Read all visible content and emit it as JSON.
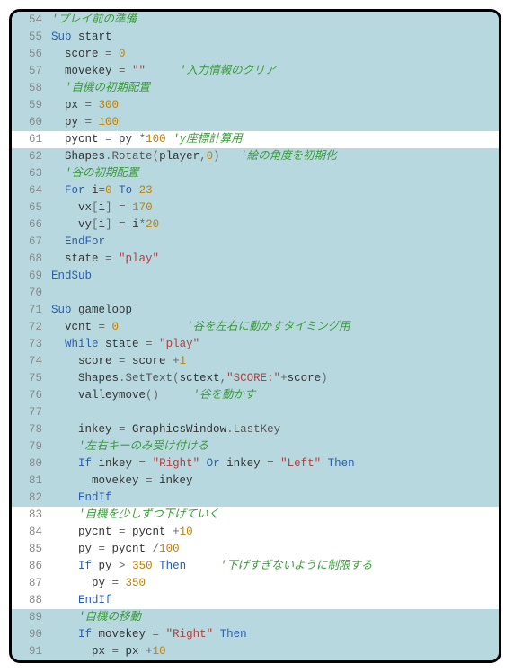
{
  "line_start": 54,
  "current_line": 61,
  "lines": [
    {
      "n": 54,
      "sel": true,
      "tokens": [
        {
          "c": "com",
          "t": "'プレイ前の準備"
        }
      ]
    },
    {
      "n": 55,
      "sel": true,
      "tokens": [
        {
          "c": "kw",
          "t": "Sub "
        },
        {
          "c": "ident",
          "t": "start"
        }
      ]
    },
    {
      "n": 56,
      "sel": true,
      "tokens": [
        {
          "c": "",
          "t": "  "
        },
        {
          "c": "ident",
          "t": "score "
        },
        {
          "c": "op",
          "t": "= "
        },
        {
          "c": "num",
          "t": "0"
        }
      ]
    },
    {
      "n": 57,
      "sel": true,
      "tokens": [
        {
          "c": "",
          "t": "  "
        },
        {
          "c": "ident",
          "t": "movekey "
        },
        {
          "c": "op",
          "t": "= "
        },
        {
          "c": "str",
          "t": "\"\""
        },
        {
          "c": "",
          "t": "     "
        },
        {
          "c": "com",
          "t": "'入力情報のクリア"
        }
      ]
    },
    {
      "n": 58,
      "sel": true,
      "tokens": [
        {
          "c": "",
          "t": "  "
        },
        {
          "c": "com",
          "t": "'自機の初期配置"
        }
      ]
    },
    {
      "n": 59,
      "sel": true,
      "tokens": [
        {
          "c": "",
          "t": "  "
        },
        {
          "c": "ident",
          "t": "px "
        },
        {
          "c": "op",
          "t": "= "
        },
        {
          "c": "num",
          "t": "300"
        }
      ]
    },
    {
      "n": 60,
      "sel": true,
      "tokens": [
        {
          "c": "",
          "t": "  "
        },
        {
          "c": "ident",
          "t": "py "
        },
        {
          "c": "op",
          "t": "= "
        },
        {
          "c": "num",
          "t": "100"
        }
      ]
    },
    {
      "n": 61,
      "sel": false,
      "tokens": [
        {
          "c": "",
          "t": "  "
        },
        {
          "c": "ident",
          "t": "pycnt "
        },
        {
          "c": "op",
          "t": "= "
        },
        {
          "c": "ident",
          "t": "py "
        },
        {
          "c": "op",
          "t": "*"
        },
        {
          "c": "num",
          "t": "100 "
        },
        {
          "c": "com",
          "t": "'y座標計算用"
        }
      ]
    },
    {
      "n": 62,
      "sel": true,
      "tokens": [
        {
          "c": "",
          "t": "  "
        },
        {
          "c": "ident",
          "t": "Shapes"
        },
        {
          "c": "op",
          "t": "."
        },
        {
          "c": "member",
          "t": "Rotate"
        },
        {
          "c": "op",
          "t": "("
        },
        {
          "c": "ident",
          "t": "player"
        },
        {
          "c": "op",
          "t": ","
        },
        {
          "c": "num",
          "t": "0"
        },
        {
          "c": "op",
          "t": ")   "
        },
        {
          "c": "com",
          "t": "'絵の角度を初期化"
        }
      ]
    },
    {
      "n": 63,
      "sel": true,
      "tokens": [
        {
          "c": "",
          "t": "  "
        },
        {
          "c": "com",
          "t": "'谷の初期配置"
        }
      ]
    },
    {
      "n": 64,
      "sel": true,
      "tokens": [
        {
          "c": "",
          "t": "  "
        },
        {
          "c": "kw",
          "t": "For "
        },
        {
          "c": "ident",
          "t": "i"
        },
        {
          "c": "op",
          "t": "="
        },
        {
          "c": "num",
          "t": "0"
        },
        {
          "c": "kw",
          "t": " To "
        },
        {
          "c": "num",
          "t": "23"
        }
      ]
    },
    {
      "n": 65,
      "sel": true,
      "tokens": [
        {
          "c": "",
          "t": "    "
        },
        {
          "c": "ident",
          "t": "vx"
        },
        {
          "c": "op",
          "t": "["
        },
        {
          "c": "ident",
          "t": "i"
        },
        {
          "c": "op",
          "t": "] = "
        },
        {
          "c": "num",
          "t": "170"
        }
      ]
    },
    {
      "n": 66,
      "sel": true,
      "tokens": [
        {
          "c": "",
          "t": "    "
        },
        {
          "c": "ident",
          "t": "vy"
        },
        {
          "c": "op",
          "t": "["
        },
        {
          "c": "ident",
          "t": "i"
        },
        {
          "c": "op",
          "t": "] = "
        },
        {
          "c": "ident",
          "t": "i"
        },
        {
          "c": "op",
          "t": "*"
        },
        {
          "c": "num",
          "t": "20"
        }
      ]
    },
    {
      "n": 67,
      "sel": true,
      "tokens": [
        {
          "c": "",
          "t": "  "
        },
        {
          "c": "kw",
          "t": "EndFor"
        }
      ]
    },
    {
      "n": 68,
      "sel": true,
      "tokens": [
        {
          "c": "",
          "t": "  "
        },
        {
          "c": "ident",
          "t": "state "
        },
        {
          "c": "op",
          "t": "= "
        },
        {
          "c": "str",
          "t": "\"play\""
        }
      ]
    },
    {
      "n": 69,
      "sel": true,
      "tokens": [
        {
          "c": "kw",
          "t": "EndSub"
        }
      ]
    },
    {
      "n": 70,
      "sel": true,
      "tokens": []
    },
    {
      "n": 71,
      "sel": true,
      "tokens": [
        {
          "c": "kw",
          "t": "Sub "
        },
        {
          "c": "ident",
          "t": "gameloop"
        }
      ]
    },
    {
      "n": 72,
      "sel": true,
      "tokens": [
        {
          "c": "",
          "t": "  "
        },
        {
          "c": "ident",
          "t": "vcnt "
        },
        {
          "c": "op",
          "t": "= "
        },
        {
          "c": "num",
          "t": "0"
        },
        {
          "c": "",
          "t": "          "
        },
        {
          "c": "com",
          "t": "'谷を左右に動かすタイミング用"
        }
      ]
    },
    {
      "n": 73,
      "sel": true,
      "tokens": [
        {
          "c": "",
          "t": "  "
        },
        {
          "c": "kw",
          "t": "While "
        },
        {
          "c": "ident",
          "t": "state "
        },
        {
          "c": "op",
          "t": "= "
        },
        {
          "c": "str",
          "t": "\"play\""
        }
      ]
    },
    {
      "n": 74,
      "sel": true,
      "tokens": [
        {
          "c": "",
          "t": "    "
        },
        {
          "c": "ident",
          "t": "score "
        },
        {
          "c": "op",
          "t": "= "
        },
        {
          "c": "ident",
          "t": "score "
        },
        {
          "c": "op",
          "t": "+"
        },
        {
          "c": "num",
          "t": "1"
        }
      ]
    },
    {
      "n": 75,
      "sel": true,
      "tokens": [
        {
          "c": "",
          "t": "    "
        },
        {
          "c": "ident",
          "t": "Shapes"
        },
        {
          "c": "op",
          "t": "."
        },
        {
          "c": "member",
          "t": "SetText"
        },
        {
          "c": "op",
          "t": "("
        },
        {
          "c": "ident",
          "t": "sctext"
        },
        {
          "c": "op",
          "t": ","
        },
        {
          "c": "str",
          "t": "\"SCORE:\""
        },
        {
          "c": "op",
          "t": "+"
        },
        {
          "c": "ident",
          "t": "score"
        },
        {
          "c": "op",
          "t": ")"
        }
      ]
    },
    {
      "n": 76,
      "sel": true,
      "tokens": [
        {
          "c": "",
          "t": "    "
        },
        {
          "c": "ident",
          "t": "valleymove"
        },
        {
          "c": "op",
          "t": "()     "
        },
        {
          "c": "com",
          "t": "'谷を動かす"
        }
      ]
    },
    {
      "n": 77,
      "sel": true,
      "tokens": []
    },
    {
      "n": 78,
      "sel": true,
      "tokens": [
        {
          "c": "",
          "t": "    "
        },
        {
          "c": "ident",
          "t": "inkey "
        },
        {
          "c": "op",
          "t": "= "
        },
        {
          "c": "ident",
          "t": "GraphicsWindow"
        },
        {
          "c": "op",
          "t": "."
        },
        {
          "c": "member",
          "t": "LastKey"
        }
      ]
    },
    {
      "n": 79,
      "sel": true,
      "tokens": [
        {
          "c": "",
          "t": "    "
        },
        {
          "c": "com",
          "t": "'左右キーのみ受け付ける"
        }
      ]
    },
    {
      "n": 80,
      "sel": true,
      "tokens": [
        {
          "c": "",
          "t": "    "
        },
        {
          "c": "kw",
          "t": "If "
        },
        {
          "c": "ident",
          "t": "inkey "
        },
        {
          "c": "op",
          "t": "= "
        },
        {
          "c": "str",
          "t": "\"Right\""
        },
        {
          "c": "kw",
          "t": " Or "
        },
        {
          "c": "ident",
          "t": "inkey "
        },
        {
          "c": "op",
          "t": "= "
        },
        {
          "c": "str",
          "t": "\"Left\""
        },
        {
          "c": "kw",
          "t": " Then"
        }
      ]
    },
    {
      "n": 81,
      "sel": true,
      "tokens": [
        {
          "c": "",
          "t": "      "
        },
        {
          "c": "ident",
          "t": "movekey "
        },
        {
          "c": "op",
          "t": "= "
        },
        {
          "c": "ident",
          "t": "inkey"
        }
      ]
    },
    {
      "n": 82,
      "sel": true,
      "tokens": [
        {
          "c": "",
          "t": "    "
        },
        {
          "c": "kw",
          "t": "EndIf"
        }
      ]
    },
    {
      "n": 83,
      "sel": false,
      "tokens": [
        {
          "c": "",
          "t": "    "
        },
        {
          "c": "com",
          "t": "'自機を少しずつ下げていく"
        }
      ]
    },
    {
      "n": 84,
      "sel": false,
      "tokens": [
        {
          "c": "",
          "t": "    "
        },
        {
          "c": "ident",
          "t": "pycnt "
        },
        {
          "c": "op",
          "t": "= "
        },
        {
          "c": "ident",
          "t": "pycnt "
        },
        {
          "c": "op",
          "t": "+"
        },
        {
          "c": "num",
          "t": "10"
        }
      ]
    },
    {
      "n": 85,
      "sel": false,
      "tokens": [
        {
          "c": "",
          "t": "    "
        },
        {
          "c": "ident",
          "t": "py "
        },
        {
          "c": "op",
          "t": "= "
        },
        {
          "c": "ident",
          "t": "pycnt "
        },
        {
          "c": "op",
          "t": "/"
        },
        {
          "c": "num",
          "t": "100"
        }
      ]
    },
    {
      "n": 86,
      "sel": false,
      "tokens": [
        {
          "c": "",
          "t": "    "
        },
        {
          "c": "kw",
          "t": "If "
        },
        {
          "c": "ident",
          "t": "py "
        },
        {
          "c": "op",
          "t": "> "
        },
        {
          "c": "num",
          "t": "350"
        },
        {
          "c": "kw",
          "t": " Then     "
        },
        {
          "c": "com",
          "t": "'下げすぎないように制限する"
        }
      ]
    },
    {
      "n": 87,
      "sel": false,
      "tokens": [
        {
          "c": "",
          "t": "      "
        },
        {
          "c": "ident",
          "t": "py "
        },
        {
          "c": "op",
          "t": "= "
        },
        {
          "c": "num",
          "t": "350"
        }
      ]
    },
    {
      "n": 88,
      "sel": false,
      "tokens": [
        {
          "c": "",
          "t": "    "
        },
        {
          "c": "kw",
          "t": "EndIf"
        }
      ]
    },
    {
      "n": 89,
      "sel": true,
      "tokens": [
        {
          "c": "",
          "t": "    "
        },
        {
          "c": "com",
          "t": "'自機の移動"
        }
      ]
    },
    {
      "n": 90,
      "sel": true,
      "tokens": [
        {
          "c": "",
          "t": "    "
        },
        {
          "c": "kw",
          "t": "If "
        },
        {
          "c": "ident",
          "t": "movekey "
        },
        {
          "c": "op",
          "t": "= "
        },
        {
          "c": "str",
          "t": "\"Right\""
        },
        {
          "c": "kw",
          "t": " Then"
        }
      ]
    },
    {
      "n": 91,
      "sel": true,
      "tokens": [
        {
          "c": "",
          "t": "      "
        },
        {
          "c": "ident",
          "t": "px "
        },
        {
          "c": "op",
          "t": "= "
        },
        {
          "c": "ident",
          "t": "px "
        },
        {
          "c": "op",
          "t": "+"
        },
        {
          "c": "num",
          "t": "10"
        }
      ]
    }
  ]
}
